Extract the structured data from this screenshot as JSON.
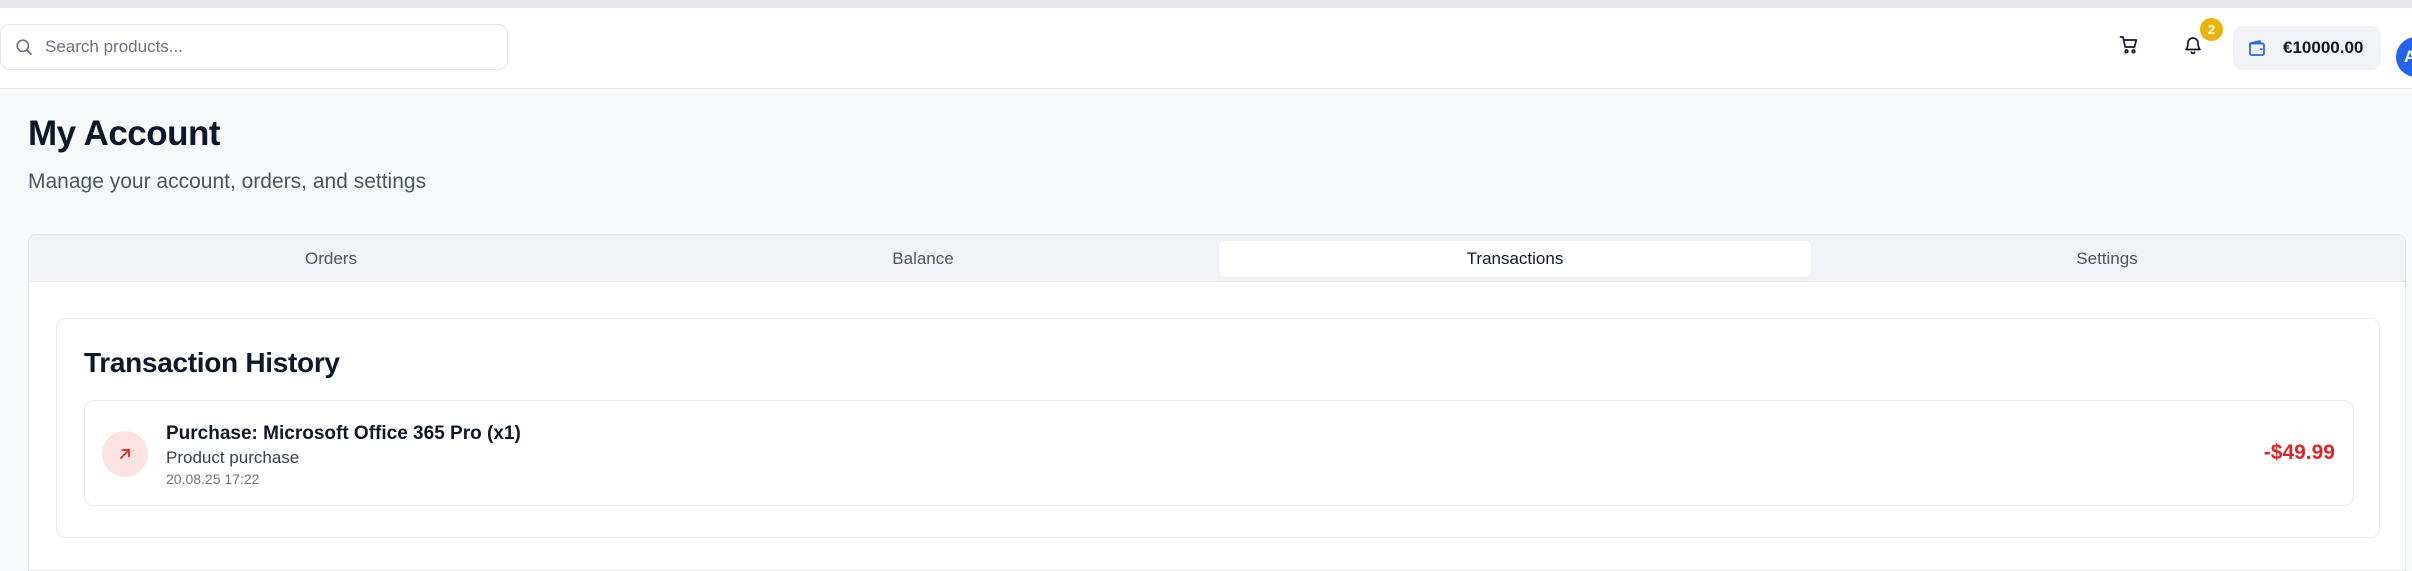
{
  "header": {
    "search": {
      "placeholder": "Search products...",
      "value": "",
      "icon": "search-icon"
    },
    "cart": {
      "icon": "shopping-cart-icon"
    },
    "notifications": {
      "icon": "bell-icon",
      "count": "2"
    },
    "balance": {
      "icon": "wallet-icon",
      "amount": "€10000.00"
    },
    "avatar": {
      "initial": "A"
    }
  },
  "page": {
    "title": "My Account",
    "subtitle": "Manage your account, orders, and settings"
  },
  "tabs": [
    {
      "label": "Orders",
      "active": false
    },
    {
      "label": "Balance",
      "active": false
    },
    {
      "label": "Transactions",
      "active": true
    },
    {
      "label": "Settings",
      "active": false
    }
  ],
  "transactions": {
    "title": "Transaction History",
    "items": [
      {
        "icon": "arrow-up-right-icon",
        "title": "Purchase: Microsoft Office 365 Pro (x1)",
        "description": "Product purchase",
        "date": "20.08.25 17:22",
        "amount": "-$49.99"
      }
    ]
  },
  "colors": {
    "accent": "#2563eb",
    "badge": "#eab308",
    "negative": "#dc2626",
    "negative_bg": "#fde2e2"
  }
}
